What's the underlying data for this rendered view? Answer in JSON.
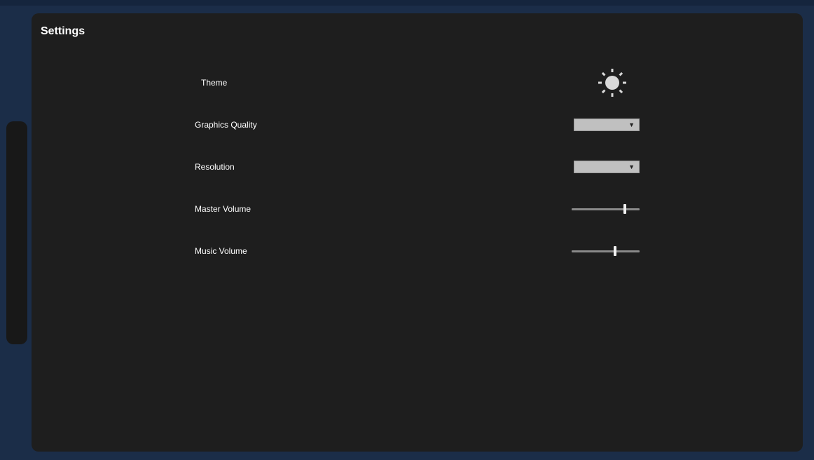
{
  "panel": {
    "title": "Settings"
  },
  "settings": {
    "theme": {
      "label": "Theme",
      "icon": "sun-icon"
    },
    "graphics_quality": {
      "label": "Graphics Quality",
      "value": ""
    },
    "resolution": {
      "label": "Resolution",
      "value": ""
    },
    "master_volume": {
      "label": "Master Volume",
      "level": 0.78
    },
    "music_volume": {
      "label": "Music Volume",
      "level": 0.64
    }
  },
  "colors": {
    "background": "#1b2d48",
    "panel": "#1e1e1e",
    "control_fill": "#c0c0c0",
    "text": "#ffffff"
  }
}
